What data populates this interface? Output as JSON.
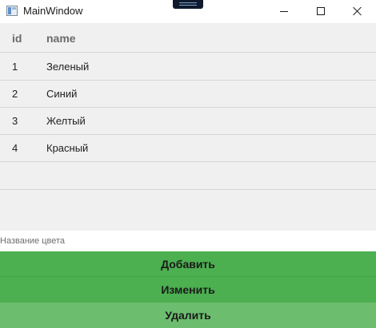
{
  "window": {
    "title": "MainWindow"
  },
  "grid": {
    "columns": [
      "id",
      "name"
    ],
    "rows": [
      {
        "id": "1",
        "name": "Зеленый"
      },
      {
        "id": "2",
        "name": "Синий"
      },
      {
        "id": "3",
        "name": "Желтый"
      },
      {
        "id": "4",
        "name": "Красный"
      }
    ]
  },
  "input": {
    "placeholder": "Название цвета",
    "value": ""
  },
  "buttons": {
    "add": "Добавить",
    "edit": "Изменить",
    "delete": "Удалить"
  },
  "colors": {
    "button_green": "#4caf50",
    "button_green_light": "#6cbd6e",
    "grid_background": "#f0f0f0"
  }
}
